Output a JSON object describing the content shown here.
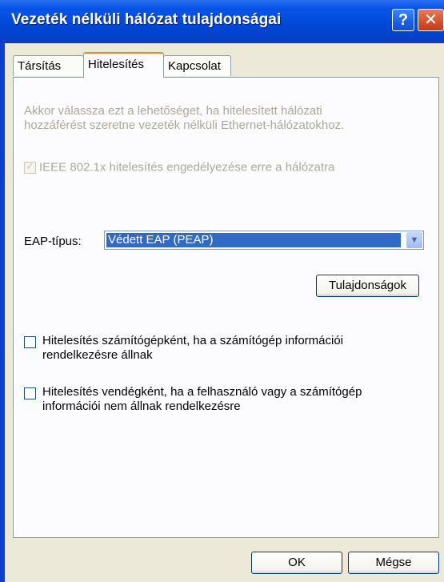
{
  "window": {
    "title": "Vezeték nélküli hálózat tulajdonságai",
    "help_glyph": "?",
    "close_glyph": "✕"
  },
  "tabs": [
    {
      "label": "Társítás",
      "active": false
    },
    {
      "label": "Hitelesítés",
      "active": true
    },
    {
      "label": "Kapcsolat",
      "active": false
    }
  ],
  "auth": {
    "description_line1": "Akkor válassza ezt a lehetőséget, ha hitelesített hálózati",
    "description_line2": "hozzáférést szeretne vezeték nélküli Ethernet-hálózatokhoz.",
    "ieee_checkbox_label": "IEEE 802.1x hitelesítés engedélyezése erre a hálózatra",
    "ieee_checked": true,
    "ieee_enabled": false,
    "eap_label": "EAP-típus:",
    "eap_value": "Védett EAP (PEAP)",
    "properties_button": "Tulajdonságok",
    "machine_auth_line1": "Hitelesítés számítógépként, ha a számítógép információi",
    "machine_auth_line2": "rendelkezésre állnak",
    "machine_auth_checked": false,
    "guest_auth_line1": "Hitelesítés vendégként, ha a felhasználó vagy a számítógép",
    "guest_auth_line2": "információi nem állnak rendelkezésre",
    "guest_auth_checked": false
  },
  "footer": {
    "ok_label": "OK",
    "cancel_label": "Mégse"
  },
  "colors": {
    "title_bar": "#0148d8",
    "dialog_bg": "#ece9d8",
    "tab_accent": "#e68b2c",
    "selection": "#316ac5"
  }
}
